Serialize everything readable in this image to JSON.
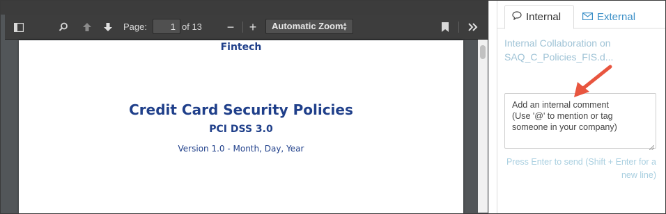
{
  "viewer": {
    "page_label": "Page:",
    "page_value": "1",
    "page_total": "of 13",
    "zoom_value": "Automatic Zoom",
    "zoom_minus": "−",
    "zoom_plus": "+"
  },
  "document": {
    "company": "Fintech",
    "title": "Credit Card Security Policies",
    "subtitle": "PCI DSS 3.0",
    "version": "Version 1.0 - Month, Day, Year"
  },
  "panel": {
    "tabs": [
      {
        "label": "Internal",
        "icon": "speech-bubble-icon"
      },
      {
        "label": "External",
        "icon": "envelope-icon"
      }
    ],
    "title": "Internal Collaboration on SAQ_C_Policies_FIS.d...",
    "comment_placeholder_line1": "Add an internal comment",
    "comment_placeholder_line2": "(Use '@' to mention or tag",
    "comment_placeholder_line3": "someone in your company)",
    "hint_line1": "Press Enter to send (Shift + Enter for a",
    "hint_line2": "new line)"
  },
  "colors": {
    "accent_link": "#3a8fc7",
    "muted_text": "#a9cfe0",
    "doc_blue": "#1f3f8a",
    "annotation_arrow": "#e8553f"
  }
}
